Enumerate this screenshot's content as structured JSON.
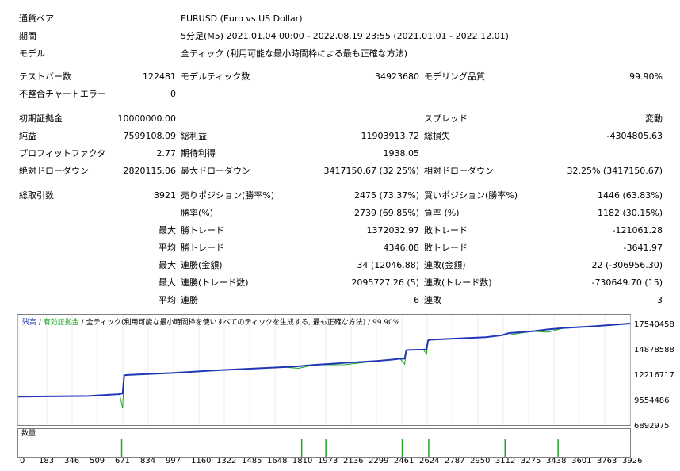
{
  "report": {
    "symbol_label": "通貨ペア",
    "symbol_value": "EURUSD (Euro vs US Dollar)",
    "period_label": "期間",
    "period_value": "5分足(M5) 2021.01.04 00:00 - 2022.08.19 23:55 (2021.01.01 - 2022.12.01)",
    "model_label": "モデル",
    "model_value": "全ティック (利用可能な最小時間枠による最も正確な方法)",
    "bars_label": "テストバー数",
    "bars_value": "122481",
    "ticks_label": "モデルティック数",
    "ticks_value": "34923680",
    "quality_label": "モデリング品質",
    "quality_value": "99.90%",
    "mismatch_label": "不整合チャートエラー",
    "mismatch_value": "0",
    "deposit_label": "初期証拠金",
    "deposit_value": "10000000.00",
    "spread_label": "スプレッド",
    "spread_value": "変動",
    "net_label": "純益",
    "net_value": "7599108.09",
    "gross_profit_label": "総利益",
    "gross_profit_value": "11903913.72",
    "gross_loss_label": "総損失",
    "gross_loss_value": "-4304805.63",
    "pf_label": "プロフィットファクタ",
    "pf_value": "2.77",
    "expected_label": "期待利得",
    "expected_value": "1938.05",
    "abs_dd_label": "絶対ドローダウン",
    "abs_dd_value": "2820115.06",
    "max_dd_label": "最大ドローダウン",
    "max_dd_value": "3417150.67 (32.25%)",
    "rel_dd_label": "相対ドローダウン",
    "rel_dd_value": "32.25% (3417150.67)",
    "trades_label": "総取引数",
    "trades_value": "3921",
    "short_label": "売りポジション(勝率%)",
    "short_value": "2475 (73.37%)",
    "long_label": "買いポジション(勝率%)",
    "long_value": "1446 (63.83%)",
    "win_rate_label": "勝率(%)",
    "win_rate_value": "2739 (69.85%)",
    "loss_rate_label": "負率 (%)",
    "loss_rate_value": "1182 (30.15%)",
    "max_word": "最大",
    "avg_word": "平均",
    "win_trade_label": "勝トレード",
    "max_win_value": "1372032.97",
    "avg_win_value": "4346.08",
    "loss_trade_label": "敗トレード",
    "max_loss_value": "-121061.28",
    "avg_loss_value": "-3641.97",
    "cons_wins_amt_label": "連勝(金額)",
    "cons_wins_amt_value": "34 (12046.88)",
    "cons_losses_amt_label": "連敗(金額)",
    "cons_losses_amt_value": "22 (-306956.30)",
    "cons_wins_trd_label": "連勝(トレード数)",
    "cons_wins_trd_value": "2095727.26 (5)",
    "cons_losses_trd_label": "連敗(トレード数)",
    "cons_losses_trd_value": "-730649.70 (15)",
    "avg_cons_wins_label": "連勝",
    "avg_cons_wins_value": "6",
    "avg_cons_losses_label": "連敗",
    "avg_cons_losses_value": "3"
  },
  "chart": {
    "legend_balance": "残高",
    "legend_sep1": " / ",
    "legend_equity": "有効証拠金",
    "legend_sep2": " / ",
    "legend_model": "全ティック(利用可能な最小時間枠を使いすべてのティックを生成する, 最も正確な方法)",
    "legend_sep3": " / ",
    "legend_quality": "99.90%",
    "volume_label": "数量",
    "y_ticks": [
      "17540458",
      "14878588",
      "12216717",
      "9554486",
      "6892975"
    ],
    "x_ticks": [
      "0",
      "183",
      "346",
      "509",
      "671",
      "834",
      "997",
      "1160",
      "1322",
      "1485",
      "1648",
      "1810",
      "1973",
      "2136",
      "2299",
      "2461",
      "2624",
      "2787",
      "2950",
      "3112",
      "3275",
      "3438",
      "3601",
      "3763",
      "3926"
    ],
    "colors": {
      "balance": "#1f36b7",
      "equity": "#22a822",
      "frame": "#808080"
    }
  },
  "chart_data": {
    "type": "line",
    "x": [
      0,
      450,
      600,
      640,
      650,
      670,
      680,
      700,
      1000,
      1300,
      1700,
      1800,
      1900,
      2100,
      2300,
      2400,
      2450,
      2480,
      2490,
      2500,
      2600,
      2620,
      2630,
      2650,
      2800,
      3000,
      3100,
      3150,
      3300,
      3400,
      3500,
      3700,
      3926
    ],
    "series": [
      {
        "name": "残高",
        "values": [
          9554486,
          9630000,
          9780000,
          9820000,
          9850000,
          9900000,
          11880000,
          11920000,
          12150000,
          12460000,
          12780000,
          12880000,
          13030000,
          13250000,
          13450000,
          13600000,
          13700000,
          13700000,
          14600000,
          14650000,
          14700000,
          14720000,
          15700000,
          15780000,
          15900000,
          16050000,
          16250000,
          16500000,
          16700000,
          16900000,
          17050000,
          17250000,
          17540458
        ]
      },
      {
        "name": "有効証拠金",
        "values": [
          9554486,
          9630000,
          9780000,
          9820000,
          9850000,
          8300000,
          11880000,
          11920000,
          12150000,
          12460000,
          12780000,
          12650000,
          13030000,
          13050000,
          13450000,
          13600000,
          13700000,
          13100000,
          14600000,
          14650000,
          14700000,
          14200000,
          15700000,
          15780000,
          15900000,
          16050000,
          16250000,
          16300000,
          16700000,
          16600000,
          17050000,
          17250000,
          17540458
        ]
      }
    ],
    "xlim": [
      0,
      3926
    ],
    "ylim": [
      6892975,
      17540458
    ]
  }
}
